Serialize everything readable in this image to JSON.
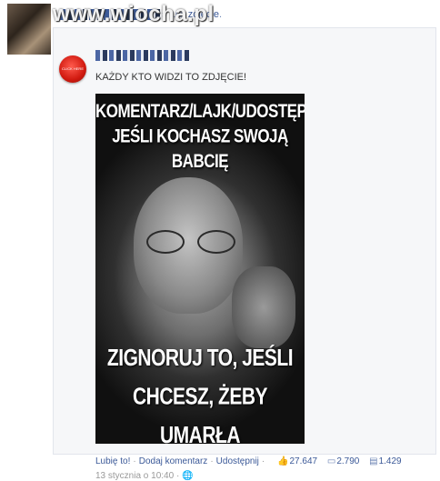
{
  "story": {
    "actor_suffix": "s",
    "verb": "lubi",
    "object_link": "zdjęcie",
    "period": ".",
    "watermark": "www.wiocha.pl"
  },
  "post": {
    "avatar_text": "CLICK HERE",
    "caption": "KAŻDY KTO WIDZI TO ZDJĘCIE!",
    "photo_top_line1": "KOMENTARZ/LAJK/UDOSTĘPNIJ,",
    "photo_top_line2": "JEŚLI KOCHASZ SWOJĄ BABCIĘ",
    "photo_bottom_line1": "ZIGNORUJ TO, JEŚLI",
    "photo_bottom_line2": "CHCESZ, ŻEBY UMARŁA"
  },
  "actions": {
    "like_label": "Lubię to!",
    "comment_label": "Dodaj komentarz",
    "share_label": "Udostępnij",
    "separator": "·",
    "likes_count": "27.647",
    "comments_count": "2.790",
    "shares_count": "1.429",
    "like_icon": "thumbs-up-icon",
    "comment_icon": "comment-icon",
    "share_icon": "share-icon"
  },
  "meta": {
    "timestamp": "13 stycznia o 10:40",
    "dot": "·",
    "audience_icon": "globe-icon"
  }
}
